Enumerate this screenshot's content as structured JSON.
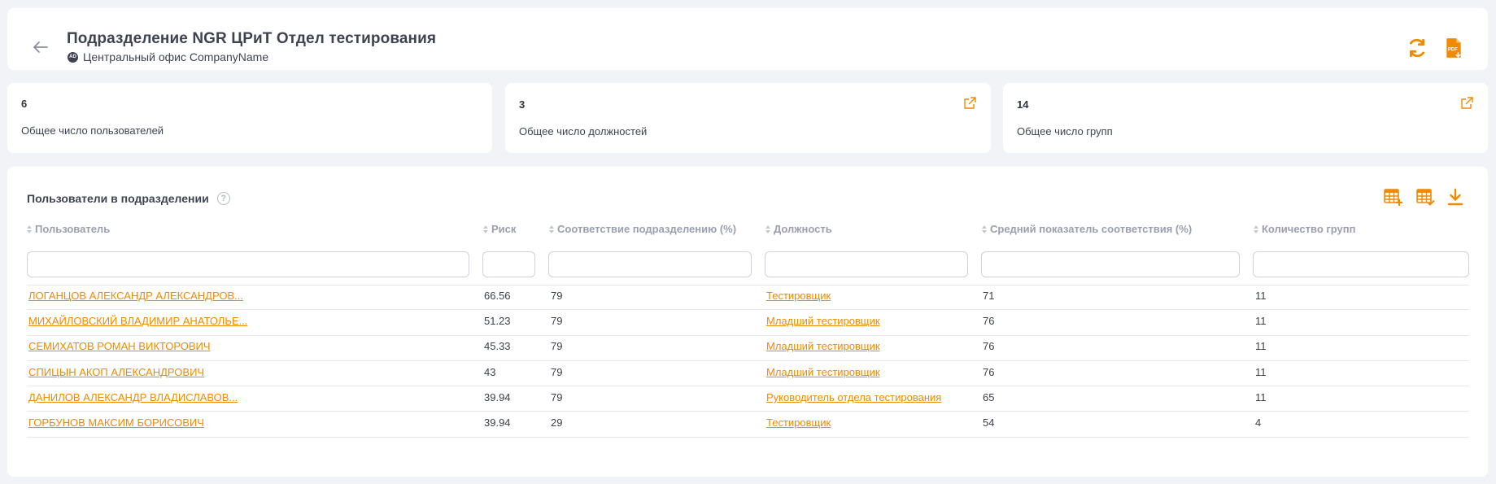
{
  "header": {
    "title": "Подразделение NGR ЦРиТ Отдел тестирования",
    "badge": "AD",
    "subtitle": "Центральный офис CompanyName"
  },
  "stats": [
    {
      "value": "6",
      "label": "Общее число пользователей"
    },
    {
      "value": "3",
      "label": "Общее число должностей"
    },
    {
      "value": "14",
      "label": "Общее число групп"
    }
  ],
  "section": {
    "title": "Пользователи в подразделении",
    "help": "?"
  },
  "columns": [
    "Пользователь",
    "Риск",
    "Соответствие подразделению (%)",
    "Должность",
    "Средний показатель соответствия (%)",
    "Количество групп"
  ],
  "rows": [
    {
      "user": "ЛОГАНЦОВ АЛЕКСАНДР АЛЕКСАНДРОВ...",
      "risk": "66.56",
      "match": "79",
      "position": "Тестировщик",
      "avg": "71",
      "groups": "11"
    },
    {
      "user": "МИХАЙЛОВСКИЙ ВЛАДИМИР АНАТОЛЬЕ...",
      "risk": "51.23",
      "match": "79",
      "position": "Младший тестировщик",
      "avg": "76",
      "groups": "11"
    },
    {
      "user": "СЕМИХАТОВ РОМАН ВИКТОРОВИЧ",
      "risk": "45.33",
      "match": "79",
      "position": "Младший тестировщик",
      "avg": "76",
      "groups": "11"
    },
    {
      "user": "СПИЦЫН АКОП АЛЕКСАНДРОВИЧ",
      "risk": "43",
      "match": "79",
      "position": "Младший тестировщик",
      "avg": "76",
      "groups": "11"
    },
    {
      "user": "ДАНИЛОВ АЛЕКСАНДР ВЛАДИСЛАВОВ...",
      "risk": "39.94",
      "match": "79",
      "position": "Руководитель отдела тестирования",
      "avg": "65",
      "groups": "11"
    },
    {
      "user": "ГОРБУНОВ МАКСИМ БОРИСОВИЧ",
      "risk": "39.94",
      "match": "29",
      "position": "Тестировщик",
      "avg": "54",
      "groups": "4"
    }
  ],
  "icons": {
    "back": "arrow-left-icon",
    "refresh": "refresh-icon",
    "pdf": "pdf-export-icon",
    "external": "external-link-icon",
    "help": "question-circle-icon",
    "table_add": "table-add-icon",
    "table_check": "table-check-icon",
    "download": "download-icon"
  },
  "colors": {
    "accent": "#f08a00",
    "background": "#f2f3f6",
    "card": "#ffffff",
    "header_text": "#9a9fb0"
  }
}
